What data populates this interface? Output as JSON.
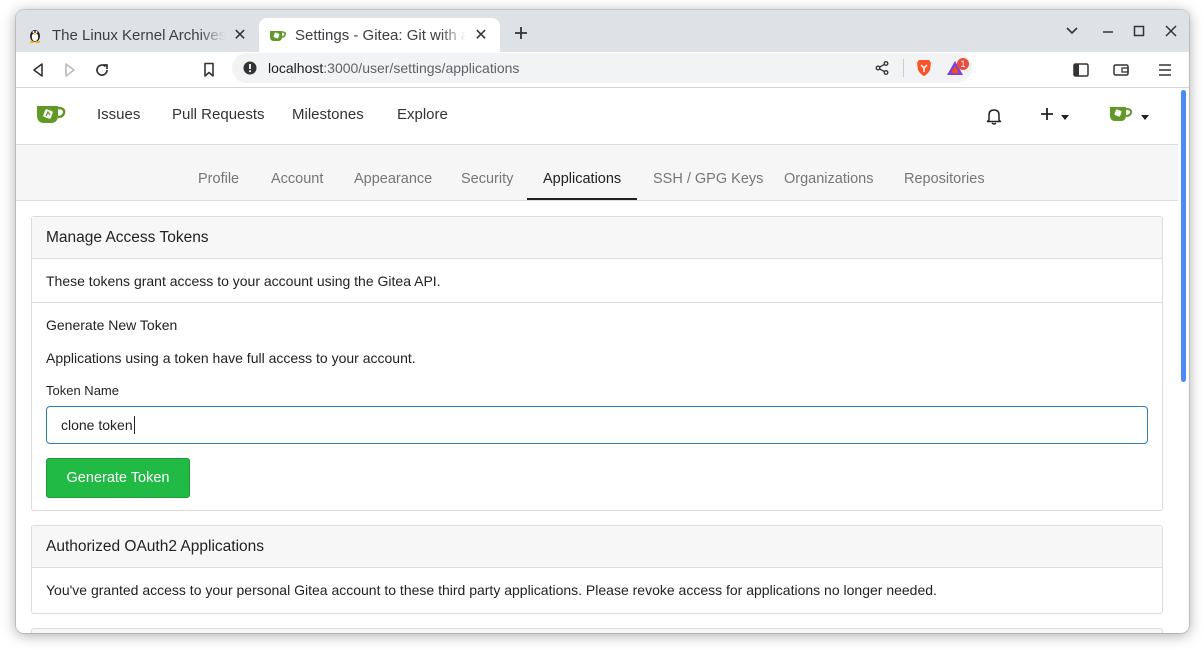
{
  "browser": {
    "tabs": [
      {
        "title": "The Linux Kernel Archives",
        "icon": "tux-icon",
        "active": false
      },
      {
        "title": "Settings - Gitea: Git with a cup of tea",
        "icon": "gitea-teacup-icon",
        "active": true
      }
    ],
    "url": {
      "host": "localhost",
      "path": ":3000/user/settings/applications"
    },
    "brave_notification_count": "1",
    "accent_color": "#4c8bf5"
  },
  "gitea": {
    "nav": [
      "Issues",
      "Pull Requests",
      "Milestones",
      "Explore"
    ],
    "settings_menu": [
      "Profile",
      "Account",
      "Appearance",
      "Security",
      "Applications",
      "SSH / GPG Keys",
      "Organizations",
      "Repositories"
    ],
    "active_menu": "Applications",
    "tokens": {
      "header": "Manage Access Tokens",
      "description": "These tokens grant access to your account using the Gitea API.",
      "new_token_title": "Generate New Token",
      "new_token_note": "Applications using a token have full access to your account.",
      "token_name_label": "Token Name",
      "token_name_value": "clone token",
      "generate_button": "Generate Token",
      "button_color": "#21ba45"
    },
    "oauth": {
      "header": "Authorized OAuth2 Applications",
      "description": "You've granted access to your personal Gitea account to these third party applications. Please revoke access for applications no longer needed."
    }
  }
}
